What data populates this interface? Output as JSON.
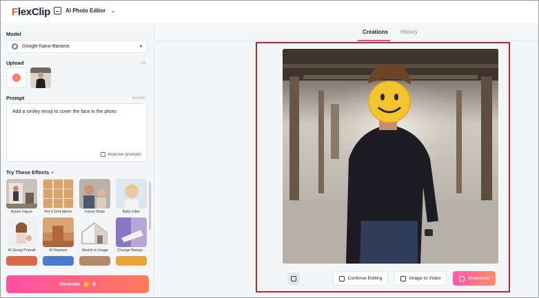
{
  "header": {
    "logo_text": "FlexClip",
    "logo_accent": "F",
    "logo_rest": "lexClip",
    "editor_label": "AI Photo Editor"
  },
  "left": {
    "model_label": "Model",
    "model_value": "Google-Nano-Banana",
    "upload_label": "Upload",
    "upload_count": "1/5",
    "prompt_label": "Prompt",
    "prompt_count": "49/3000",
    "prompt_text": "Add a smiley emoji to cover the face in the photo",
    "improve_label": "Improve prompts",
    "effects_title": "Try These Effects",
    "effects": [
      {
        "label": "Action Figure"
      },
      {
        "label": "Pet 9 Grid Meme"
      },
      {
        "label": "Future Baby"
      },
      {
        "label": "Baby Filter"
      },
      {
        "label": "AI Group Portrait"
      },
      {
        "label": "AI Replace"
      },
      {
        "label": "Sketch to Image"
      },
      {
        "label": "Change Backgr..."
      }
    ],
    "generate_label": "Generate",
    "generate_cost": "-8"
  },
  "right": {
    "tabs": [
      {
        "label": "Creations",
        "active": true
      },
      {
        "label": "History",
        "active": false
      }
    ],
    "actions": {
      "continue_label": "Continue Editing",
      "video_label": "Image to Video",
      "download_label": "Download"
    }
  },
  "colors": {
    "accent_pink": "#ff4fa7",
    "accent_orange": "#ff7a5a",
    "highlight_red": "#c0262b",
    "tab_underline": "#e84a6f"
  },
  "icons": [
    "google-icon",
    "upload-icon",
    "improve-icon",
    "sparkle-icon",
    "coin-icon",
    "copy-icon",
    "edit-icon",
    "video-icon",
    "download-icon",
    "chevron-down-icon"
  ]
}
